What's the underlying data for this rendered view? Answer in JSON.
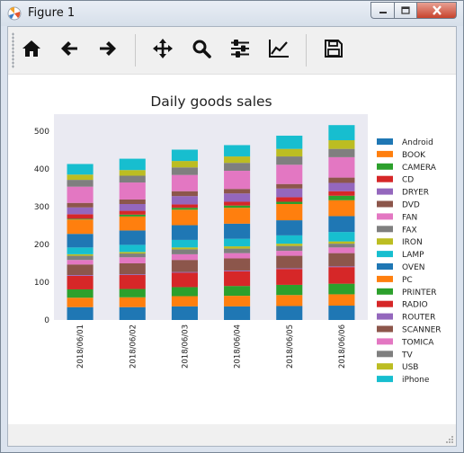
{
  "window": {
    "title": "Figure 1"
  },
  "toolbar": {
    "buttons": [
      "home-icon",
      "back-arrow-icon",
      "forward-arrow-icon",
      "pan-move-icon",
      "zoom-magnifier-icon",
      "configure-subplots-icon",
      "edit-axis-icon",
      "save-disk-icon"
    ]
  },
  "chart_data": {
    "type": "bar",
    "stacked": true,
    "title": "Daily goods sales",
    "xlabel": "",
    "ylabel": "",
    "categories": [
      "2018/06/01",
      "2018/06/02",
      "2018/06/03",
      "2018/06/04",
      "2018/06/05",
      "2018/06/06"
    ],
    "ylim": [
      0,
      545
    ],
    "yticks": [
      0,
      100,
      200,
      300,
      400,
      500
    ],
    "grid": false,
    "legend_placement": "right",
    "series": [
      {
        "name": "Android",
        "color": "#1f77b4",
        "values": [
          34,
          34,
          36,
          36,
          37,
          38
        ]
      },
      {
        "name": "BOOK",
        "color": "#ff7f0e",
        "values": [
          25,
          26,
          27,
          28,
          29,
          30
        ]
      },
      {
        "name": "CAMERA",
        "color": "#2ca02c",
        "values": [
          22,
          22,
          24,
          26,
          27,
          28
        ]
      },
      {
        "name": "CD",
        "color": "#d62728",
        "values": [
          36,
          37,
          38,
          39,
          42,
          44
        ]
      },
      {
        "name": "DRYER",
        "color": "#9467bd",
        "values": [
          2,
          2,
          2,
          2,
          2,
          2
        ]
      },
      {
        "name": "DVD",
        "color": "#8c564b",
        "values": [
          28,
          29,
          32,
          32,
          33,
          35
        ]
      },
      {
        "name": "FAN",
        "color": "#e377c2",
        "values": [
          12,
          16,
          15,
          14,
          13,
          15
        ]
      },
      {
        "name": "FAX",
        "color": "#7f7f7f",
        "values": [
          11,
          10,
          13,
          12,
          13,
          10
        ]
      },
      {
        "name": "IRON",
        "color": "#bcbd22",
        "values": [
          4,
          4,
          5,
          6,
          6,
          6
        ]
      },
      {
        "name": "LAMP",
        "color": "#17becf",
        "values": [
          18,
          19,
          20,
          20,
          22,
          25
        ]
      },
      {
        "name": "OVEN",
        "color": "#1f77b4",
        "values": [
          36,
          38,
          39,
          40,
          40,
          42
        ]
      },
      {
        "name": "PC",
        "color": "#ff7f0e",
        "values": [
          38,
          37,
          41,
          42,
          43,
          42
        ]
      },
      {
        "name": "PRINTER",
        "color": "#2ca02c",
        "values": [
          2,
          5,
          5,
          6,
          6,
          12
        ]
      },
      {
        "name": "RADIO",
        "color": "#d62728",
        "values": [
          12,
          10,
          9,
          10,
          12,
          12
        ]
      },
      {
        "name": "ROUTER",
        "color": "#9467bd",
        "values": [
          18,
          18,
          22,
          22,
          23,
          22
        ]
      },
      {
        "name": "SCANNER",
        "color": "#8c564b",
        "values": [
          12,
          12,
          13,
          12,
          12,
          14
        ]
      },
      {
        "name": "TOMICA",
        "color": "#e377c2",
        "values": [
          43,
          45,
          43,
          48,
          51,
          54
        ]
      },
      {
        "name": "TV",
        "color": "#7f7f7f",
        "values": [
          18,
          18,
          20,
          21,
          22,
          22
        ]
      },
      {
        "name": "USB",
        "color": "#bcbd22",
        "values": [
          14,
          15,
          17,
          17,
          20,
          23
        ]
      },
      {
        "name": "iPhone",
        "color": "#17becf",
        "values": [
          28,
          30,
          30,
          30,
          35,
          40
        ]
      }
    ]
  }
}
